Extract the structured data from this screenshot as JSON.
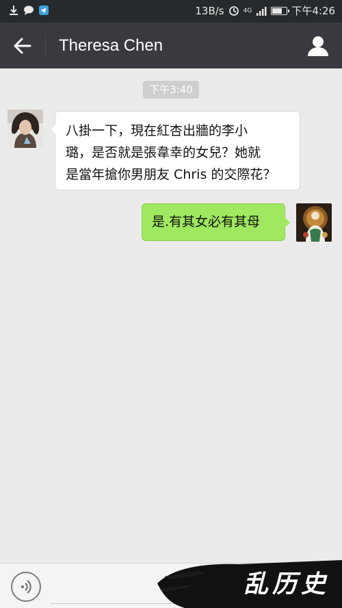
{
  "status_bar": {
    "speed": "13B/s",
    "network": "4G",
    "time": "下午4:26",
    "battery_level": 0.6,
    "left_icons": [
      "download-icon",
      "chat-bubble-icon",
      "telegram-icon"
    ]
  },
  "header": {
    "title": "Theresa Chen",
    "back_icon": "arrow-left-icon",
    "profile_icon": "person-icon",
    "background": "#393a3f"
  },
  "chat": {
    "timestamp": "下午3:40",
    "messages": [
      {
        "sender": "Theresa Chen",
        "side": "left",
        "lines": [
          "八掛一下，現在紅杏出牆的李小",
          "璐，是否就是張韋幸的女兒？她就",
          "是當年搶你男朋友 Chris 的交際花？"
        ]
      },
      {
        "sender": "me",
        "side": "right",
        "text": "是.有其女必有其母",
        "bubble_color": "#9fe85f"
      }
    ]
  },
  "input_bar": {
    "voice_icon": "voice-icon"
  },
  "watermark": {
    "text": "乱历史"
  }
}
